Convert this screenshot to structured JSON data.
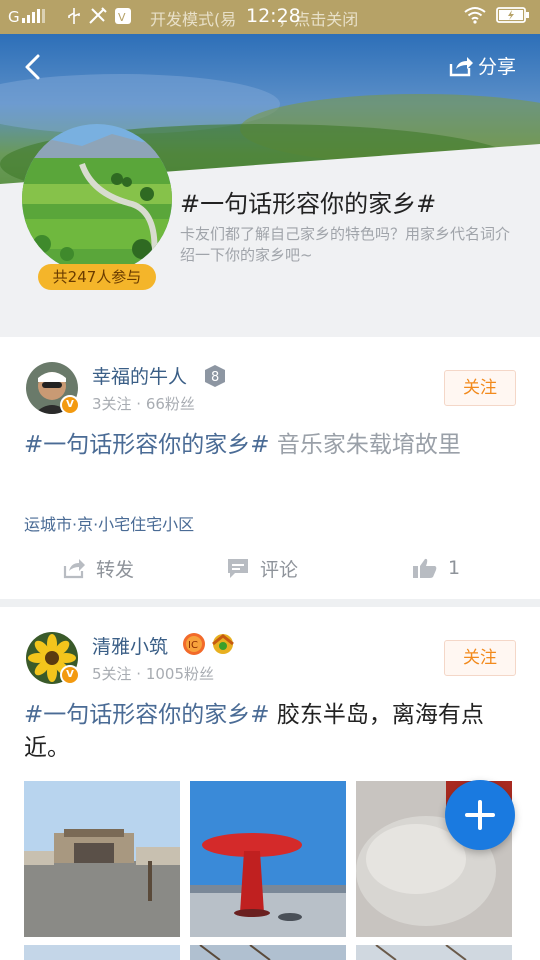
{
  "status_bar": {
    "dev_mode_text": "开发模式(易",
    "dev_mode_suffix": "，点击关闭",
    "time": "12:28"
  },
  "header": {
    "share_label": "分享"
  },
  "topic": {
    "title": "#一句话形容你的家乡#",
    "description": "卡友们都了解自己家乡的特色吗？用家乡代名词介绍一下你的家乡吧~",
    "participants": "共247人参与"
  },
  "posts": [
    {
      "user_name": "幸福的牛人",
      "level": "8",
      "meta": "3关注 · 66粉丝",
      "follow_label": "关注",
      "hashtag": "#一句话形容你的家乡#",
      "body": " 音乐家朱载堉故里",
      "location": "运城市·京·小宅住宅小区",
      "repost_label": "转发",
      "comment_label": "评论",
      "like_count": "1"
    },
    {
      "user_name": "清雅小筑",
      "meta": "5关注 · 1005粉丝",
      "follow_label": "关注",
      "hashtag": "#一句话形容你的家乡#",
      "body": " 胶东半岛，离海有点近。"
    }
  ],
  "colors": {
    "accent_blue": "#1a7ae0",
    "hashtag_blue": "#4a6b95",
    "follow_orange": "#f28a1c",
    "badge_yellow": "#f4b52a"
  }
}
